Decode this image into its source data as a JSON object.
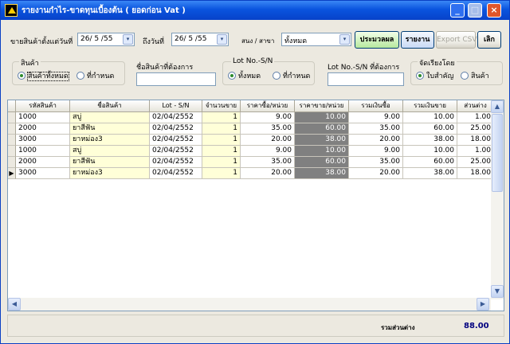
{
  "window": {
    "title": "รายงานกำไร-ขาดทุนเบื้องต้น ( ยอดก่อน Vat )",
    "min": "_",
    "max": "□",
    "close": "×"
  },
  "toolbar": {
    "date_from_label": "ขายสินค้าตั้งแต่วันที่",
    "date_from": "26/ 5 /55",
    "date_to_label": "ถึงวันที่",
    "date_to": "26/ 5 /55",
    "branch_label": "สนง / สาขา",
    "branch_value": "ทั้งหมด",
    "process": "ประมวลผล",
    "report": "รายงาน",
    "export": "Export CSV",
    "exit": "เลิก"
  },
  "filters": {
    "product_group": "สินค้า",
    "product_all": "สินค้าทั้งหมด",
    "product_custom": "ที่กำหนด",
    "product_name_label": "ชื่อสินค้าที่ต้องการ",
    "lot_group": "Lot No.-S/N",
    "lot_all": "ทั้งหมด",
    "lot_custom": "ที่กำหนด",
    "lot_needed_label": "Lot No.-S/N  ที่ต้องการ",
    "sort_group": "จัดเรียงโดย",
    "sort_receipt": "ใบสำคัญ",
    "sort_product": "สินค้า"
  },
  "table": {
    "columns": [
      "รหัสสินค้า",
      "ชื่อสินค้า",
      "Lot - S/N",
      "จำนวนขาย",
      "ราคาซื้อ/หน่วย",
      "ราคาขาย/หน่วย",
      "รวมเงินซื้อ",
      "รวมเงินขาย",
      "ส่วนต่าง"
    ],
    "rows": [
      [
        "1000",
        "สบู่",
        "02/04/2552",
        "1",
        "9.00",
        "10.00",
        "9.00",
        "10.00",
        "1.00"
      ],
      [
        "2000",
        "ยาสีฟัน",
        "02/04/2552",
        "1",
        "35.00",
        "60.00",
        "35.00",
        "60.00",
        "25.00"
      ],
      [
        "3000",
        "ยาหม่อง3",
        "02/04/2552",
        "1",
        "20.00",
        "38.00",
        "20.00",
        "38.00",
        "18.00"
      ],
      [
        "1000",
        "สบู่",
        "02/04/2552",
        "1",
        "9.00",
        "10.00",
        "9.00",
        "10.00",
        "1.00"
      ],
      [
        "2000",
        "ยาสีฟัน",
        "02/04/2552",
        "1",
        "35.00",
        "60.00",
        "35.00",
        "60.00",
        "25.00"
      ],
      [
        "3000",
        "ยาหม่อง3",
        "02/04/2552",
        "1",
        "20.00",
        "38.00",
        "20.00",
        "38.00",
        "18.00"
      ]
    ],
    "current_row_marker": "▶"
  },
  "footer": {
    "total_label": "รวมส่วนต่าง",
    "total_value": "88.00"
  },
  "colors": {
    "titlebar": "#0a54de",
    "highlight": "#ffffd8",
    "dark_col": "#808080",
    "total": "#00007f"
  }
}
